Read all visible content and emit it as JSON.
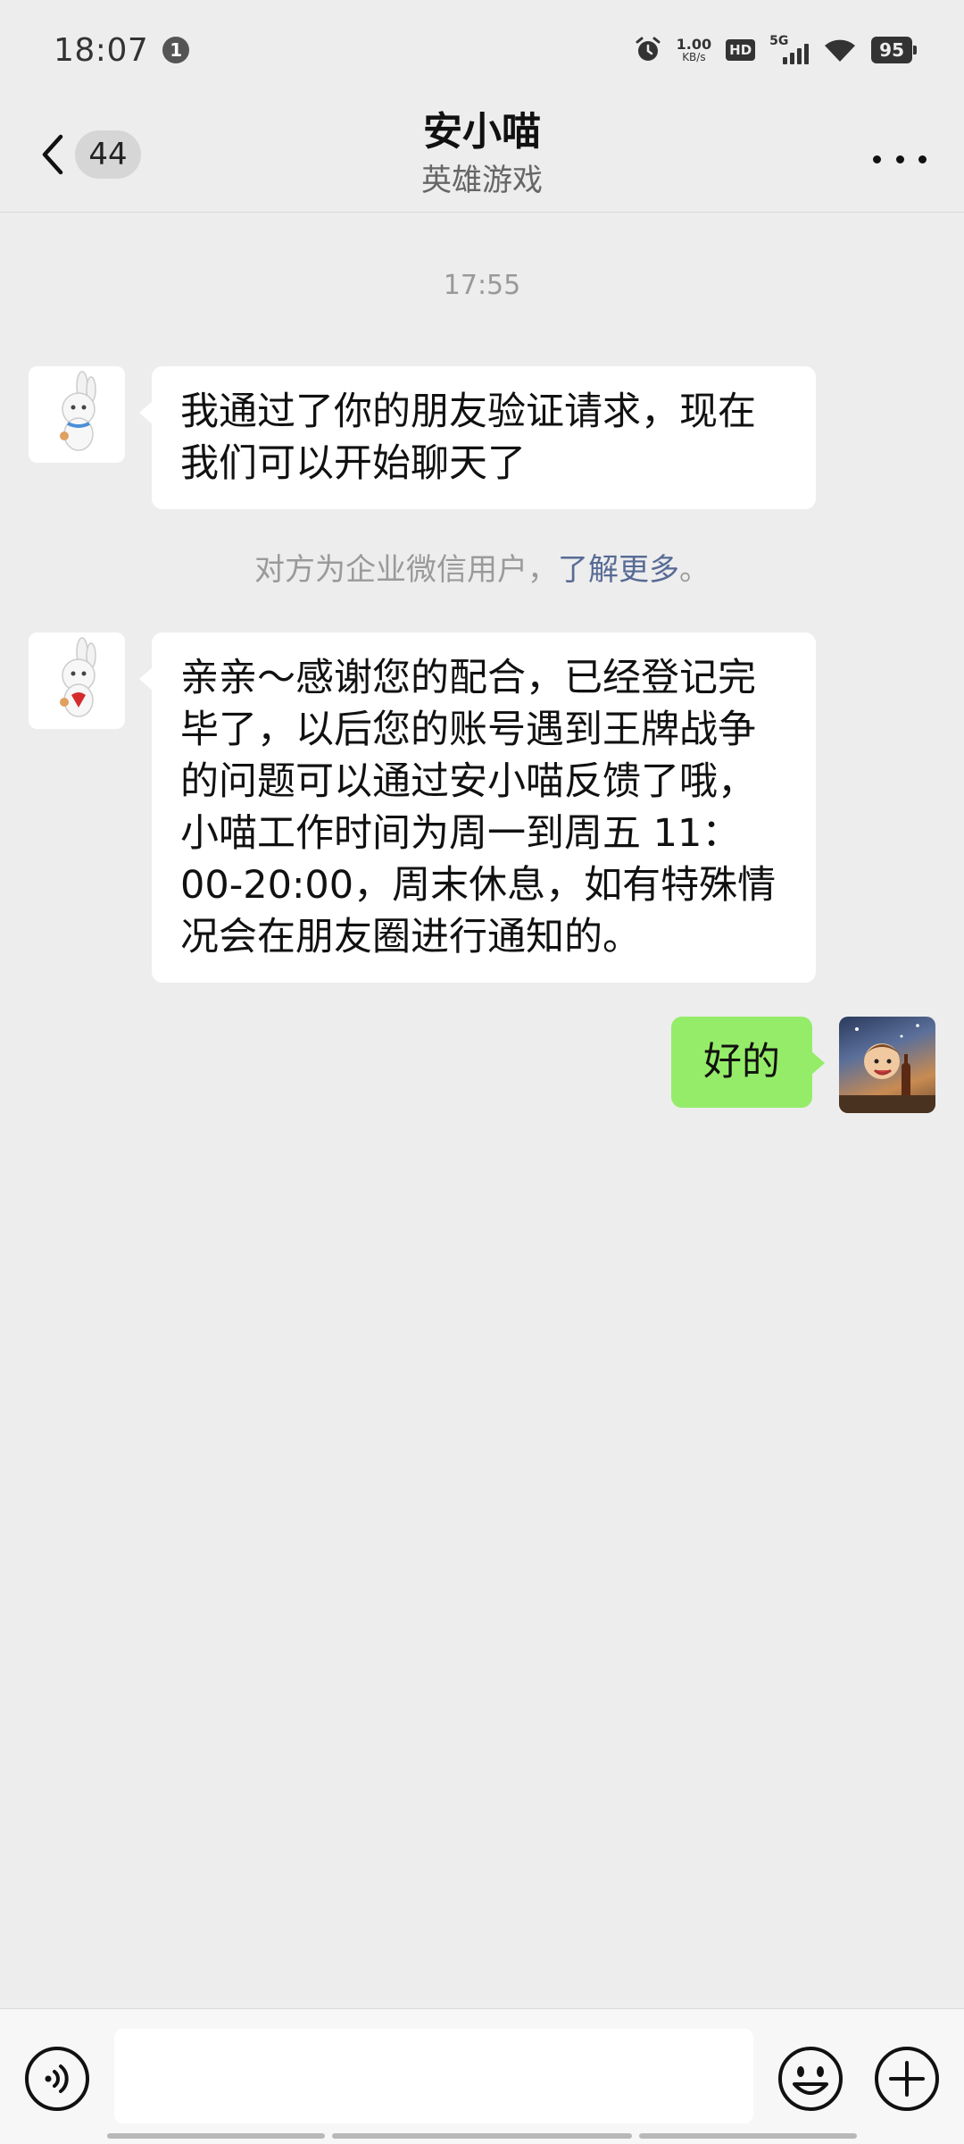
{
  "status_bar": {
    "time": "18:07",
    "notification_count": "1",
    "net_speed_value": "1.00",
    "net_speed_unit": "KB/s",
    "hd_label": "HD",
    "network_label": "5G",
    "battery": "95"
  },
  "header": {
    "unread_count": "44",
    "title": "安小喵",
    "subtitle": "英雄游戏"
  },
  "chat": {
    "timestamp": "17:55",
    "messages": [
      {
        "side": "left",
        "text": "我通过了你的朋友验证请求，现在我们可以开始聊天了"
      },
      {
        "side": "left",
        "text": "亲亲～感谢您的配合，已经登记完毕了，以后您的账号遇到王牌战争的问题可以通过安小喵反馈了哦，小喵工作时间为周一到周五 11：00-20:00，周末休息，如有特殊情况会在朋友圈进行通知的。"
      },
      {
        "side": "right",
        "text": "好的"
      }
    ],
    "system_note": {
      "text": "对方为企业微信用户，",
      "link": "了解更多",
      "suffix": "。"
    }
  },
  "input_bar": {
    "voice_icon": "voice-icon",
    "emoji_icon": "emoji-icon",
    "plus_icon": "plus-icon"
  },
  "colors": {
    "background": "#ededed",
    "bubble_self": "#95ec69",
    "bubble_other": "#ffffff",
    "link": "#576b95"
  }
}
